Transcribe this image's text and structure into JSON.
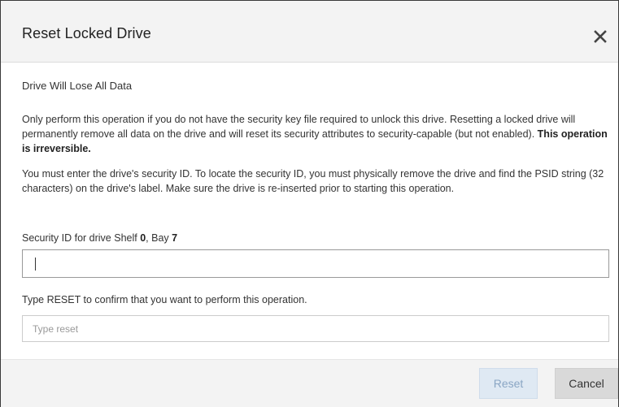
{
  "dialog": {
    "title": "Reset Locked Drive",
    "subtitle": "Drive Will Lose All Data",
    "paragraph1": "Only perform this operation if you do not have the security key file required to unlock this drive. Resetting a locked drive will permanently remove all data on the drive and will reset its security attributes to security-capable (but not enabled).",
    "paragraph1_bold": "This operation is irreversible.",
    "paragraph2": "You must enter the drive's security ID. To locate the security ID, you must physically remove the drive and find the PSID string (32 characters) on the drive's label. Make sure the drive is re-inserted prior to starting this operation.",
    "security_id_label": {
      "prefix": "Security ID for drive Shelf ",
      "shelf": "0",
      "middle": ", Bay ",
      "bay": "7"
    },
    "security_id_value": "",
    "confirm_label": "Type RESET to confirm that you want to perform this operation.",
    "confirm_placeholder": "Type reset",
    "confirm_value": ""
  },
  "buttons": {
    "reset_label": "Reset",
    "cancel_label": "Cancel"
  },
  "icons": {
    "close": "close-icon"
  }
}
